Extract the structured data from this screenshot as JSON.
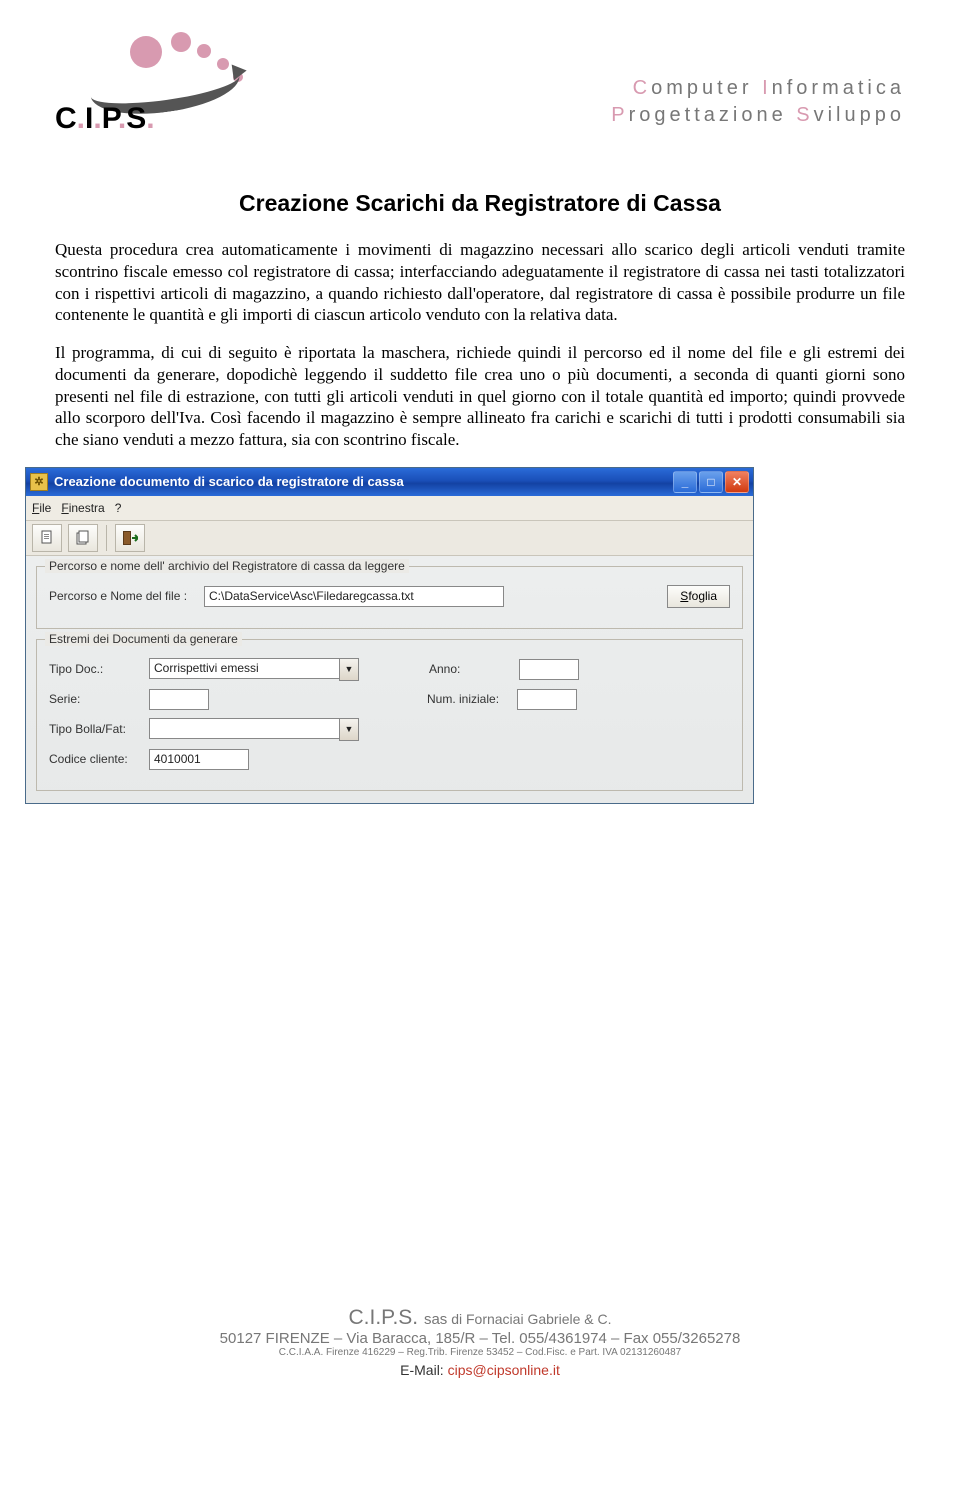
{
  "logo": {
    "text": "C.I.P.S."
  },
  "tagline": {
    "line1_a": "C",
    "line1_b": "omputer ",
    "line1_c": "I",
    "line1_d": "nformatica",
    "line2_a": "P",
    "line2_b": "rogettazione ",
    "line2_c": "S",
    "line2_d": "viluppo"
  },
  "title": "Creazione Scarichi da Registratore di Cassa",
  "para1": "Questa procedura crea automaticamente i movimenti di magazzino necessari allo scarico degli articoli venduti tramite scontrino fiscale emesso col registratore di cassa; interfacciando adeguatamente il registratore di cassa nei tasti totalizzatori con i rispettivi articoli di magazzino, a quando richiesto dall'operatore, dal registratore di cassa è possibile produrre un file contenente le quantità e gli importi di ciascun articolo venduto con la relativa data.",
  "para2": "Il programma, di cui di seguito è riportata la maschera, richiede quindi il percorso ed il nome del file e gli estremi dei documenti da generare, dopodichè leggendo il suddetto file crea uno o più documenti, a seconda di quanti giorni sono presenti nel file di estrazione, con tutti gli articoli venduti in quel giorno con il totale quantità ed importo; quindi provvede allo scorporo dell'Iva. Così facendo il magazzino è sempre allineato fra carichi e scarichi di tutti i prodotti consumabili sia che siano venduti a mezzo fattura, sia con scontrino fiscale.",
  "window": {
    "title": "Creazione documento di scarico da registratore di cassa",
    "menu": {
      "file": "File",
      "finestra": "Finestra",
      "help": "?"
    },
    "group1": {
      "legend": "Percorso e nome dell' archivio del Registratore di cassa da leggere",
      "label": "Percorso e Nome del file :",
      "value": "C:\\DataService\\Asc\\Filedaregcassa.txt",
      "browse": "Sfoglia"
    },
    "group2": {
      "legend": "Estremi dei Documenti da generare",
      "tipodoc_label": "Tipo Doc.:",
      "tipodoc_value": "Corrispettivi emessi",
      "anno_label": "Anno:",
      "anno_value": "",
      "serie_label": "Serie:",
      "serie_value": "",
      "numiniz_label": "Num. iniziale:",
      "numiniz_value": "",
      "tipobolla_label": "Tipo Bolla/Fat:",
      "tipobolla_value": "",
      "codcliente_label": "Codice cliente:",
      "codcliente_value": "4010001"
    }
  },
  "footer": {
    "l1a": "C.I.P.S. ",
    "l1b": "sas",
    "l1c": " di Fornaciai Gabriele & C.",
    "l2": "50127 FIRENZE – Via Baracca, 185/R – Tel. 055/4361974 – Fax 055/3265278",
    "l3": "C.C.I.A.A. Firenze 416229 – Reg.Trib. Firenze 53452 – Cod.Fisc. e Part. IVA 02131260487",
    "l4a": "E-Mail: ",
    "l4b": "cips@cipsonline.it"
  }
}
